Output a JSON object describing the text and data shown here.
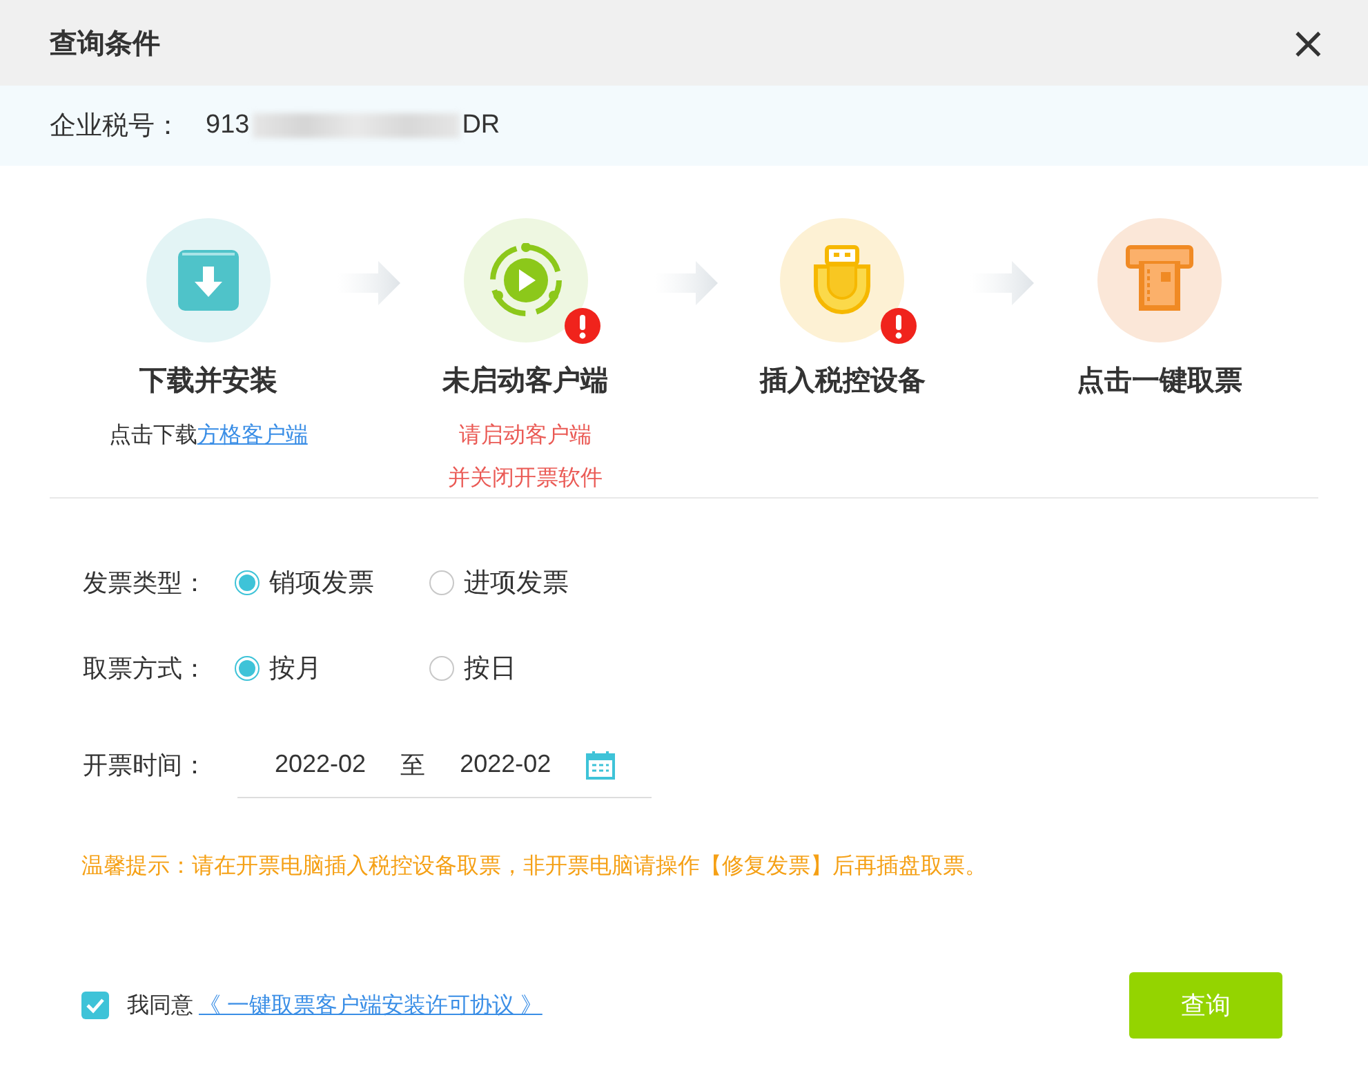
{
  "dialog": {
    "title": "查询条件",
    "close": "×"
  },
  "tax_number": {
    "label": "企业税号：",
    "value_start": "913",
    "value_end": "DR"
  },
  "steps": [
    {
      "kind": "download",
      "title": "下载并安装",
      "warning": false,
      "note": {
        "kind": "link",
        "text": "点击下载",
        "link": "方格客户端"
      }
    },
    {
      "kind": "client",
      "title": "未启动客户端",
      "warning": true,
      "note": {
        "kind": "alert",
        "lines": [
          "请启动客户端",
          "并关闭开票软件"
        ]
      }
    },
    {
      "kind": "usb",
      "title": "插入税控设备",
      "warning": true
    },
    {
      "kind": "ticket",
      "title": "点击一键取票",
      "warning": false
    }
  ],
  "form": {
    "invoice_type": {
      "label": "发票类型：",
      "options": [
        {
          "label": "销项发票",
          "selected": true
        },
        {
          "label": "进项发票",
          "selected": false
        }
      ]
    },
    "fetch_mode": {
      "label": "取票方式：",
      "options": [
        {
          "label": "按月",
          "selected": true
        },
        {
          "label": "按日",
          "selected": false
        }
      ]
    },
    "date_range": {
      "label": "开票时间：",
      "from": "2022-02",
      "separator": "至",
      "to": "2022-02"
    }
  },
  "tip": "温馨提示：请在开票电脑插入税控设备取票，非开票电脑请操作【修复发票】后再插盘取票。",
  "agreement": {
    "checked": true,
    "text": "我同意",
    "link": "《 一键取票客户端安装许可协议 》"
  },
  "query_button": "查询"
}
